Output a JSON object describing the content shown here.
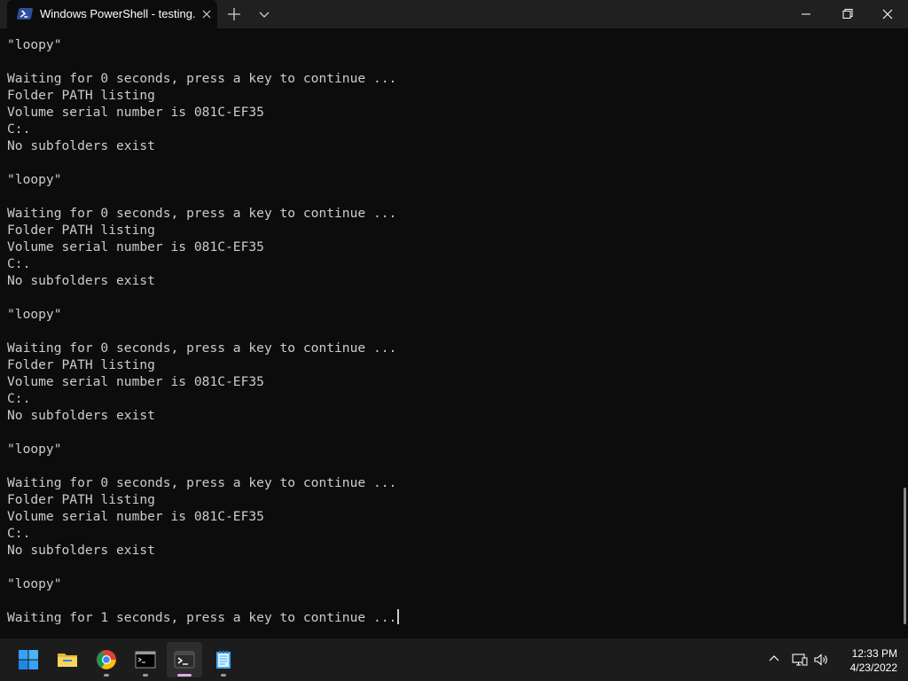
{
  "window": {
    "tab_title": "Windows PowerShell - testing.b",
    "tab_icon": "powershell-icon",
    "buttons": [
      "minimize-icon",
      "maximize-icon",
      "close-icon"
    ]
  },
  "terminal": {
    "lines": [
      "\"loopy\"",
      "",
      "Waiting for 0 seconds, press a key to continue ...",
      "Folder PATH listing",
      "Volume serial number is 081C-EF35",
      "C:.",
      "No subfolders exist",
      "",
      "\"loopy\"",
      "",
      "Waiting for 0 seconds, press a key to continue ...",
      "Folder PATH listing",
      "Volume serial number is 081C-EF35",
      "C:.",
      "No subfolders exist",
      "",
      "\"loopy\"",
      "",
      "Waiting for 0 seconds, press a key to continue ...",
      "Folder PATH listing",
      "Volume serial number is 081C-EF35",
      "C:.",
      "No subfolders exist",
      "",
      "\"loopy\"",
      "",
      "Waiting for 0 seconds, press a key to continue ...",
      "Folder PATH listing",
      "Volume serial number is 081C-EF35",
      "C:.",
      "No subfolders exist",
      "",
      "\"loopy\"",
      "",
      "Waiting for 1 seconds, press a key to continue ..."
    ],
    "background": "#0c0c0c",
    "foreground": "#cccccc"
  },
  "taskbar": {
    "apps": [
      {
        "name": "start",
        "icon": "windows-start-icon",
        "running": false,
        "active": false
      },
      {
        "name": "file-explorer",
        "icon": "folder-icon",
        "running": false,
        "active": false
      },
      {
        "name": "chrome",
        "icon": "chrome-icon",
        "running": true,
        "active": false
      },
      {
        "name": "command-prompt",
        "icon": "cmd-icon",
        "running": true,
        "active": false
      },
      {
        "name": "windows-terminal",
        "icon": "terminal-icon",
        "running": true,
        "active": true
      },
      {
        "name": "notepad",
        "icon": "notepad-icon",
        "running": true,
        "active": false
      }
    ],
    "tray_icons": [
      "chevron-up-icon",
      "network-icon",
      "volume-icon"
    ],
    "clock": {
      "time": "12:33 PM",
      "date": "4/23/2022"
    }
  }
}
